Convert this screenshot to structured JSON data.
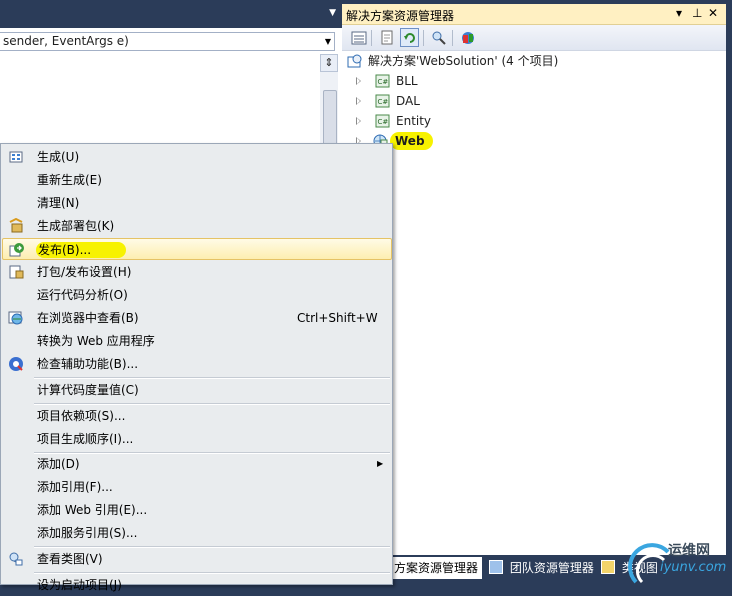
{
  "editor": {
    "member_combo": "sender, EventArgs e)",
    "splitter_glyph": "⇕"
  },
  "solution_explorer": {
    "title": "解决方案资源管理器",
    "title_buttons": {
      "pin_menu": "▾",
      "pin": "⊥",
      "close": "✕"
    },
    "toolbar": [
      "properties-icon",
      "show-all-files-icon",
      "refresh-icon",
      "class-diagram-icon",
      "copy-web-icon"
    ],
    "tree": {
      "solution": "解决方案'WebSolution' (4 个项目)",
      "projects": [
        {
          "label": "BLL",
          "icon": "csharp-project-icon"
        },
        {
          "label": "DAL",
          "icon": "csharp-project-icon"
        },
        {
          "label": "Entity",
          "icon": "csharp-project-icon"
        },
        {
          "label": "Web",
          "icon": "web-project-icon",
          "selected": true
        }
      ]
    }
  },
  "bottom_tabs": [
    {
      "label": "方案资源管理器",
      "active": true
    },
    {
      "label": "团队资源管理器",
      "active": false
    },
    {
      "label": "类视图",
      "active": false
    }
  ],
  "watermark": {
    "text_cn": "运维网",
    "text_url": "iyunv.com"
  },
  "context_menu": {
    "items": [
      {
        "label": "生成(U)",
        "icon": "build-icon"
      },
      {
        "label": "重新生成(E)"
      },
      {
        "label": "清理(N)"
      },
      {
        "label": "生成部署包(K)",
        "icon": "deploy-package-icon"
      },
      {
        "label": "发布(B)...",
        "icon": "publish-icon",
        "highlighted": true
      },
      {
        "label": "打包/发布设置(H)",
        "icon": "package-settings-icon"
      },
      {
        "label": "运行代码分析(O)"
      },
      {
        "label": "在浏览器中查看(B)",
        "icon": "view-in-browser-icon",
        "shortcut": "Ctrl+Shift+W"
      },
      {
        "label": "转换为 Web 应用程序"
      },
      {
        "label": "检查辅助功能(B)...",
        "icon": "accessibility-icon"
      },
      {
        "label": "计算代码度量值(C)"
      },
      {
        "label": "项目依赖项(S)..."
      },
      {
        "label": "项目生成顺序(I)..."
      },
      {
        "label": "添加(D)",
        "submenu": true
      },
      {
        "label": "添加引用(F)..."
      },
      {
        "label": "添加 Web 引用(E)..."
      },
      {
        "label": "添加服务引用(S)..."
      },
      {
        "label": "查看类图(V)",
        "icon": "class-diagram-icon"
      },
      {
        "label": "设为启动项目(J)"
      }
    ],
    "submenu_arrow": "▶"
  },
  "colors": {
    "chrome": "#2b3c59",
    "highlight_marker": "#f7f200",
    "menu_bg": "#e9ecee",
    "title_bar": "#fff0c2"
  }
}
